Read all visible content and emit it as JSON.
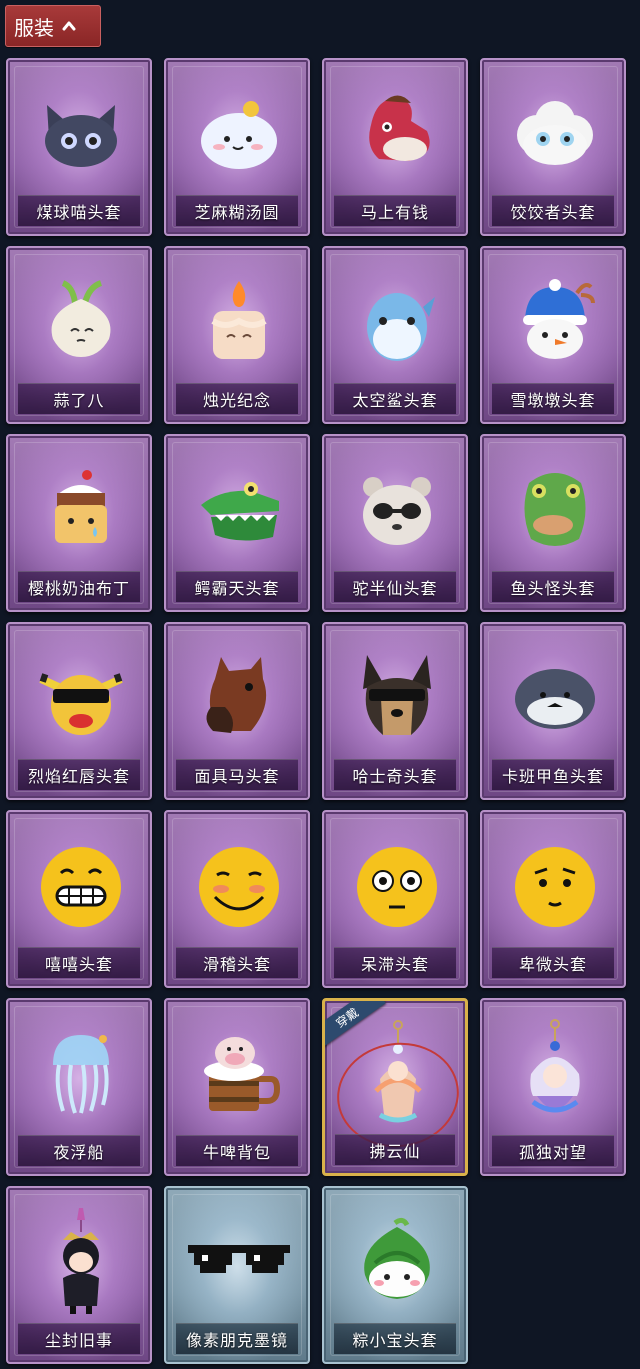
{
  "header": {
    "tab_label": "服装"
  },
  "items": [
    {
      "label": "煤球喵头套",
      "icon": "cat-head-icon"
    },
    {
      "label": "芝麻糊汤圆",
      "icon": "dumpling-icon"
    },
    {
      "label": "马上有钱",
      "icon": "horse-head-icon"
    },
    {
      "label": "饺饺者头套",
      "icon": "cloud-head-icon"
    },
    {
      "label": "蒜了八",
      "icon": "garlic-icon"
    },
    {
      "label": "烛光纪念",
      "icon": "candle-icon"
    },
    {
      "label": "太空鲨头套",
      "icon": "shark-head-icon"
    },
    {
      "label": "雪墩墩头套",
      "icon": "snowman-head-icon"
    },
    {
      "label": "樱桃奶油布丁",
      "icon": "pudding-icon"
    },
    {
      "label": "鳄霸天头套",
      "icon": "crocodile-head-icon"
    },
    {
      "label": "驼半仙头套",
      "icon": "panda-head-icon"
    },
    {
      "label": "鱼头怪头套",
      "icon": "fish-head-icon"
    },
    {
      "label": "烈焰红唇头套",
      "icon": "yellow-mask-icon"
    },
    {
      "label": "面具马头套",
      "icon": "horse-mask-icon"
    },
    {
      "label": "哈士奇头套",
      "icon": "dog-head-icon"
    },
    {
      "label": "卡班甲鱼头套",
      "icon": "seal-head-icon"
    },
    {
      "label": "嘻嘻头套",
      "icon": "grin-emoji-icon"
    },
    {
      "label": "滑稽头套",
      "icon": "smirk-emoji-icon"
    },
    {
      "label": "呆滞头套",
      "icon": "stare-emoji-icon"
    },
    {
      "label": "卑微头套",
      "icon": "timid-emoji-icon"
    },
    {
      "label": "夜浮船",
      "icon": "jellyfish-icon"
    },
    {
      "label": "牛啤背包",
      "icon": "beer-mug-icon"
    },
    {
      "label": "拂云仙",
      "icon": "fairy-charm-icon",
      "badge": "穿戴"
    },
    {
      "label": "孤独对望",
      "icon": "doll-charm-icon"
    },
    {
      "label": "尘封旧事",
      "icon": "character-charm-icon"
    },
    {
      "label": "像素朋克墨镜",
      "icon": "pixel-sunglasses-icon"
    },
    {
      "label": "粽小宝头套",
      "icon": "zongzi-head-icon"
    }
  ]
}
